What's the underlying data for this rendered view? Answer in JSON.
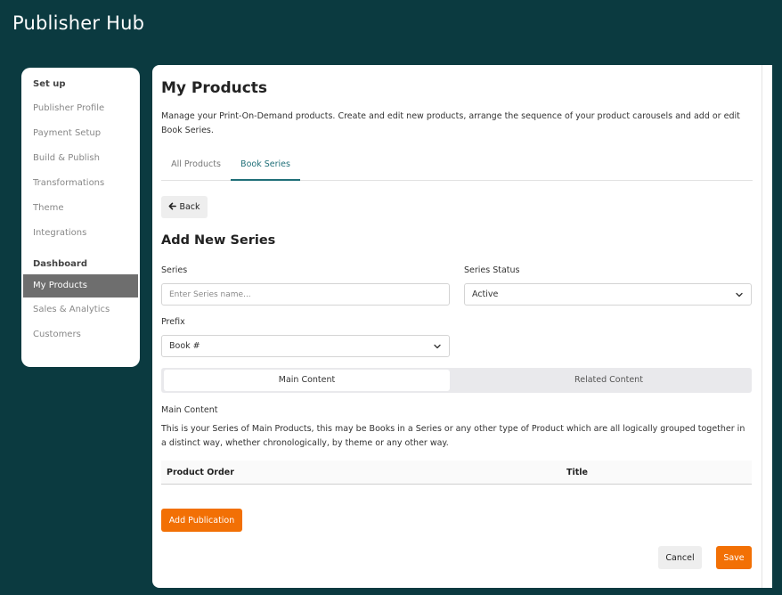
{
  "app": {
    "title": "Publisher Hub"
  },
  "sidebar": {
    "setup_heading": "Set up",
    "setup_items": [
      "Publisher Profile",
      "Payment Setup",
      "Build & Publish",
      "Transformations",
      "Theme",
      "Integrations"
    ],
    "dashboard_heading": "Dashboard",
    "dashboard_items": [
      "My Products",
      "Sales & Analytics",
      "Customers"
    ],
    "active_item": "My Products"
  },
  "page": {
    "title": "My Products",
    "description": "Manage your Print-On-Demand products. Create and edit new products, arrange the sequence of your product carousels and add or edit Book Series.",
    "tabs": [
      {
        "label": "All Products"
      },
      {
        "label": "Book Series"
      }
    ],
    "active_tab": "Book Series"
  },
  "form": {
    "back_label": "Back",
    "section_title": "Add New Series",
    "series_label": "Series",
    "series_placeholder": "Enter Series name...",
    "series_value": "",
    "status_label": "Series Status",
    "status_value": "Active",
    "prefix_label": "Prefix",
    "prefix_value": "Book #",
    "segments": [
      {
        "label": "Main Content"
      },
      {
        "label": "Related Content"
      }
    ],
    "active_segment": "Main Content",
    "main_content_title": "Main Content",
    "main_content_desc": "This is your Series of Main Products, this may be Books in a Series or any other type of Product which are all logically grouped together in a distinct way, whether chronologically, by theme or any other way.",
    "table_headers": [
      "Product Order",
      "Title"
    ],
    "add_publication_label": "Add Publication",
    "cancel_label": "Cancel",
    "save_label": "Save"
  },
  "colors": {
    "background": "#0b3a40",
    "accent": "#1f6f78",
    "primary_button": "#f27005",
    "active_nav": "#6e6e6e"
  },
  "icons": {
    "back": "arrow-left-icon",
    "dropdown": "chevron-down-icon"
  }
}
